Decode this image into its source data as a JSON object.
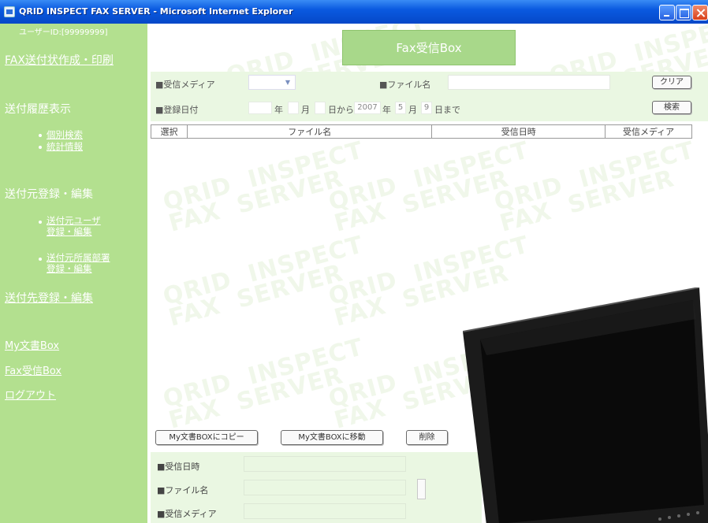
{
  "window": {
    "title": "QRID INSPECT FAX SERVER - Microsoft Internet Explorer"
  },
  "sidebar": {
    "user_id": "ユーザーID:[99999999]",
    "fax_send_create": "FAX送付状作成・印刷",
    "history_heading": "送付履歴表示",
    "history_items": [
      "個別検索",
      "統計情報"
    ],
    "sender_heading": "送付元登録・編集",
    "sender_items": [
      {
        "line1": "送付元ユーザ",
        "line2": "登録・編集"
      },
      {
        "line1": "送付元所属部署",
        "line2": "登録・編集"
      }
    ],
    "dest_link": "送付先登録・編集",
    "my_box": "My文書Box",
    "fax_box": "Fax受信Box",
    "logout": "ログアウト"
  },
  "main": {
    "title": "Fax受信Box",
    "watermark_line1": "QRID  INSPECT",
    "watermark_line2": "FAX  SERVER"
  },
  "filter": {
    "media_label": "■受信メディア",
    "media_selected": "",
    "filename_label": "■ファイル名",
    "filename_value": "",
    "clear_button": "クリア",
    "date_label": "■登録日付",
    "from_year": "",
    "from_year_unit": "年",
    "from_month": "",
    "from_month_unit": "月",
    "from_day": "",
    "from_day_unit": "日から",
    "to_year": "2007",
    "to_year_unit": "年",
    "to_month": "5",
    "to_month_unit": "月",
    "to_day": "9",
    "to_day_unit": "日まで",
    "search_button": "検索"
  },
  "table": {
    "columns": [
      "選択",
      "ファイル名",
      "受信日時",
      "受信メディア"
    ],
    "rows": []
  },
  "actions": {
    "copy_button": "My文書BOXにコピー",
    "move_button": "My文書BOXに移動",
    "delete_button": "削除"
  },
  "details": {
    "received_label": "■受信日時",
    "filename_label": "■ファイル名",
    "media_label": "■受信メディア"
  },
  "icons": {
    "dropdown": "chevron-down-icon"
  }
}
